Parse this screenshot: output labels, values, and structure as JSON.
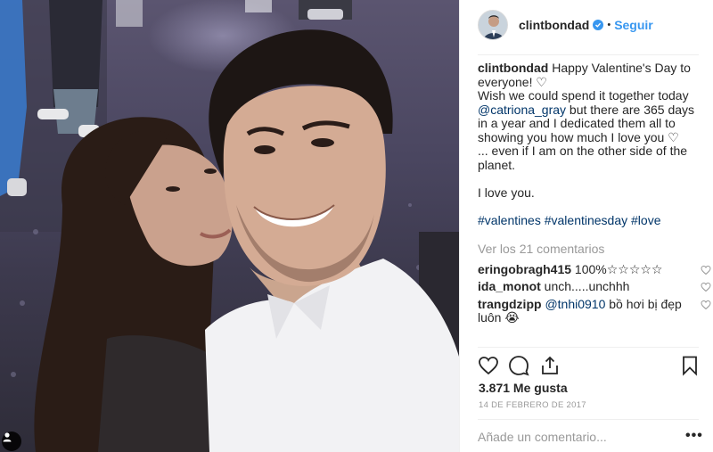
{
  "post": {
    "username": "clintbondad",
    "follow_label": "Seguir",
    "separator": "•",
    "caption": {
      "username": "clintbondad",
      "line1": "Happy Valentine's Day to everyone! ♡",
      "line2a": "Wish we could spend it together today ",
      "mention": "@catriona_gray",
      "line2b": " but there are 365 days in a year and I dedicated them all to showing you how much I love you ♡",
      "line3": "... even if I am on the other side of the planet.",
      "line4": "I love you.",
      "hashtags": [
        "#valentines",
        "#valentinesday",
        "#love"
      ]
    },
    "view_all_comments": "Ver los 21 comentarios",
    "comments": [
      {
        "username": "eringobragh415",
        "text": "100%☆☆☆☆☆"
      },
      {
        "username": "ida_monot",
        "text": "unch.....unchhh"
      },
      {
        "username": "trangdzipp",
        "mention": "@tnhi0910",
        "text": " bồ hơi bị đẹp luôn 😭"
      }
    ],
    "likes": "3.871 Me gusta",
    "date": "14 DE FEBRERO DE 2017",
    "add_comment_placeholder": "Añade un comentario...",
    "more_label": "•••"
  },
  "icons": {
    "verified": "verified-badge-icon",
    "like": "heart-icon",
    "comment": "comment-bubble-icon",
    "share": "share-icon",
    "save": "bookmark-icon",
    "user_tag": "user-tag-icon",
    "comment_like": "heart-icon"
  },
  "colors": {
    "accent": "#3897f0",
    "text": "#262626",
    "muted": "#999999",
    "link": "#003569",
    "border": "#efefef"
  }
}
